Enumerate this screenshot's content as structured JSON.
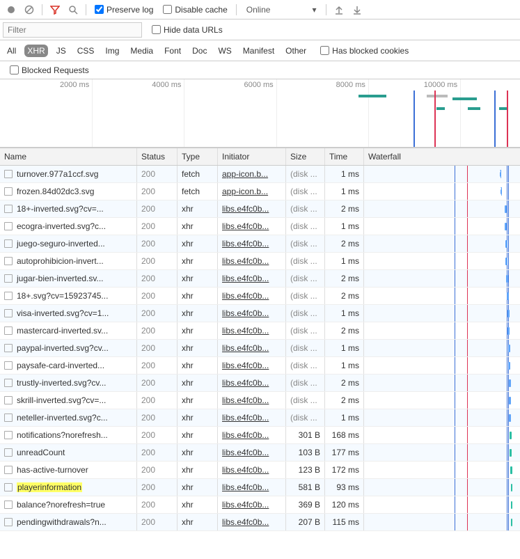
{
  "toolbar": {
    "preserve_log": "Preserve log",
    "disable_cache": "Disable cache",
    "online": "Online"
  },
  "filter": {
    "placeholder": "Filter",
    "hide_data_urls": "Hide data URLs"
  },
  "types": [
    "All",
    "XHR",
    "JS",
    "CSS",
    "Img",
    "Media",
    "Font",
    "Doc",
    "WS",
    "Manifest",
    "Other"
  ],
  "has_blocked_cookies": "Has blocked cookies",
  "blocked_requests": "Blocked Requests",
  "timeline_labels": [
    "2000 ms",
    "4000 ms",
    "6000 ms",
    "8000 ms",
    "10000 ms"
  ],
  "columns": {
    "name": "Name",
    "status": "Status",
    "type": "Type",
    "initiator": "Initiator",
    "size": "Size",
    "time": "Time",
    "waterfall": "Waterfall"
  },
  "rows": [
    {
      "name": "turnover.977a1ccf.svg",
      "status": "200",
      "type": "fetch",
      "initiator": "app-icon.b...",
      "size": "(disk ...",
      "time": "1 ms",
      "disk": true,
      "wf": {
        "style": "dash",
        "pos": 195
      }
    },
    {
      "name": "frozen.84d02dc3.svg",
      "status": "200",
      "type": "fetch",
      "initiator": "app-icon.b...",
      "size": "(disk ...",
      "time": "1 ms",
      "disk": true,
      "wf": {
        "style": "dash",
        "pos": 196
      }
    },
    {
      "name": "18+-inverted.svg?cv=...",
      "status": "200",
      "type": "xhr",
      "initiator": "libs.e4fc0b...",
      "size": "(disk ...",
      "time": "2 ms",
      "disk": true,
      "wf": {
        "style": "bluebar",
        "pos": 202
      }
    },
    {
      "name": "ecogra-inverted.svg?c...",
      "status": "200",
      "type": "xhr",
      "initiator": "libs.e4fc0b...",
      "size": "(disk ...",
      "time": "1 ms",
      "disk": true,
      "wf": {
        "style": "bluebar",
        "pos": 202
      }
    },
    {
      "name": "juego-seguro-inverted...",
      "status": "200",
      "type": "xhr",
      "initiator": "libs.e4fc0b...",
      "size": "(disk ...",
      "time": "2 ms",
      "disk": true,
      "wf": {
        "style": "bluebar",
        "pos": 203
      }
    },
    {
      "name": "autoprohibicion-invert...",
      "status": "200",
      "type": "xhr",
      "initiator": "libs.e4fc0b...",
      "size": "(disk ...",
      "time": "1 ms",
      "disk": true,
      "wf": {
        "style": "bluebar",
        "pos": 203
      }
    },
    {
      "name": "jugar-bien-inverted.sv...",
      "status": "200",
      "type": "xhr",
      "initiator": "libs.e4fc0b...",
      "size": "(disk ...",
      "time": "2 ms",
      "disk": true,
      "wf": {
        "style": "bluebar",
        "pos": 204
      }
    },
    {
      "name": "18+.svg?cv=15923745...",
      "status": "200",
      "type": "xhr",
      "initiator": "libs.e4fc0b...",
      "size": "(disk ...",
      "time": "2 ms",
      "disk": true,
      "wf": {
        "style": "bluebar",
        "pos": 205
      }
    },
    {
      "name": "visa-inverted.svg?cv=1...",
      "status": "200",
      "type": "xhr",
      "initiator": "libs.e4fc0b...",
      "size": "(disk ...",
      "time": "1 ms",
      "disk": true,
      "wf": {
        "style": "bluebar",
        "pos": 206
      }
    },
    {
      "name": "mastercard-inverted.sv...",
      "status": "200",
      "type": "xhr",
      "initiator": "libs.e4fc0b...",
      "size": "(disk ...",
      "time": "2 ms",
      "disk": true,
      "wf": {
        "style": "bluebar",
        "pos": 206
      }
    },
    {
      "name": "paypal-inverted.svg?cv...",
      "status": "200",
      "type": "xhr",
      "initiator": "libs.e4fc0b...",
      "size": "(disk ...",
      "time": "1 ms",
      "disk": true,
      "wf": {
        "style": "bluebar",
        "pos": 207
      }
    },
    {
      "name": "paysafe-card-inverted...",
      "status": "200",
      "type": "xhr",
      "initiator": "libs.e4fc0b...",
      "size": "(disk ...",
      "time": "1 ms",
      "disk": true,
      "wf": {
        "style": "bluebar",
        "pos": 207
      }
    },
    {
      "name": "trustly-inverted.svg?cv...",
      "status": "200",
      "type": "xhr",
      "initiator": "libs.e4fc0b...",
      "size": "(disk ...",
      "time": "2 ms",
      "disk": true,
      "wf": {
        "style": "bluebar",
        "pos": 208
      }
    },
    {
      "name": "skrill-inverted.svg?cv=...",
      "status": "200",
      "type": "xhr",
      "initiator": "libs.e4fc0b...",
      "size": "(disk ...",
      "time": "2 ms",
      "disk": true,
      "wf": {
        "style": "bluebar",
        "pos": 208
      }
    },
    {
      "name": "neteller-inverted.svg?c...",
      "status": "200",
      "type": "xhr",
      "initiator": "libs.e4fc0b...",
      "size": "(disk ...",
      "time": "1 ms",
      "disk": true,
      "wf": {
        "style": "bluebar",
        "pos": 208
      }
    },
    {
      "name": "notifications?norefresh...",
      "status": "200",
      "type": "xhr",
      "initiator": "libs.e4fc0b...",
      "size": "301 B",
      "time": "168 ms",
      "disk": false,
      "wf": {
        "style": "teal",
        "pos": 209,
        "w": 3
      }
    },
    {
      "name": "unreadCount",
      "status": "200",
      "type": "xhr",
      "initiator": "libs.e4fc0b...",
      "size": "103 B",
      "time": "177 ms",
      "disk": false,
      "wf": {
        "style": "teal",
        "pos": 209,
        "w": 3
      }
    },
    {
      "name": "has-active-turnover",
      "status": "200",
      "type": "xhr",
      "initiator": "libs.e4fc0b...",
      "size": "123 B",
      "time": "172 ms",
      "disk": false,
      "wf": {
        "style": "teal",
        "pos": 210,
        "w": 3
      }
    },
    {
      "name": "playerinformation",
      "status": "200",
      "type": "xhr",
      "initiator": "libs.e4fc0b...",
      "size": "581 B",
      "time": "93 ms",
      "disk": false,
      "hl": true,
      "wf": {
        "style": "teal",
        "pos": 211,
        "w": 2
      }
    },
    {
      "name": "balance?norefresh=true",
      "status": "200",
      "type": "xhr",
      "initiator": "libs.e4fc0b...",
      "size": "369 B",
      "time": "120 ms",
      "disk": false,
      "wf": {
        "style": "teal",
        "pos": 211,
        "w": 2
      }
    },
    {
      "name": "pendingwithdrawals?n...",
      "status": "200",
      "type": "xhr",
      "initiator": "libs.e4fc0b...",
      "size": "207 B",
      "time": "115 ms",
      "disk": false,
      "wf": {
        "style": "teal",
        "pos": 211,
        "w": 2
      }
    }
  ]
}
